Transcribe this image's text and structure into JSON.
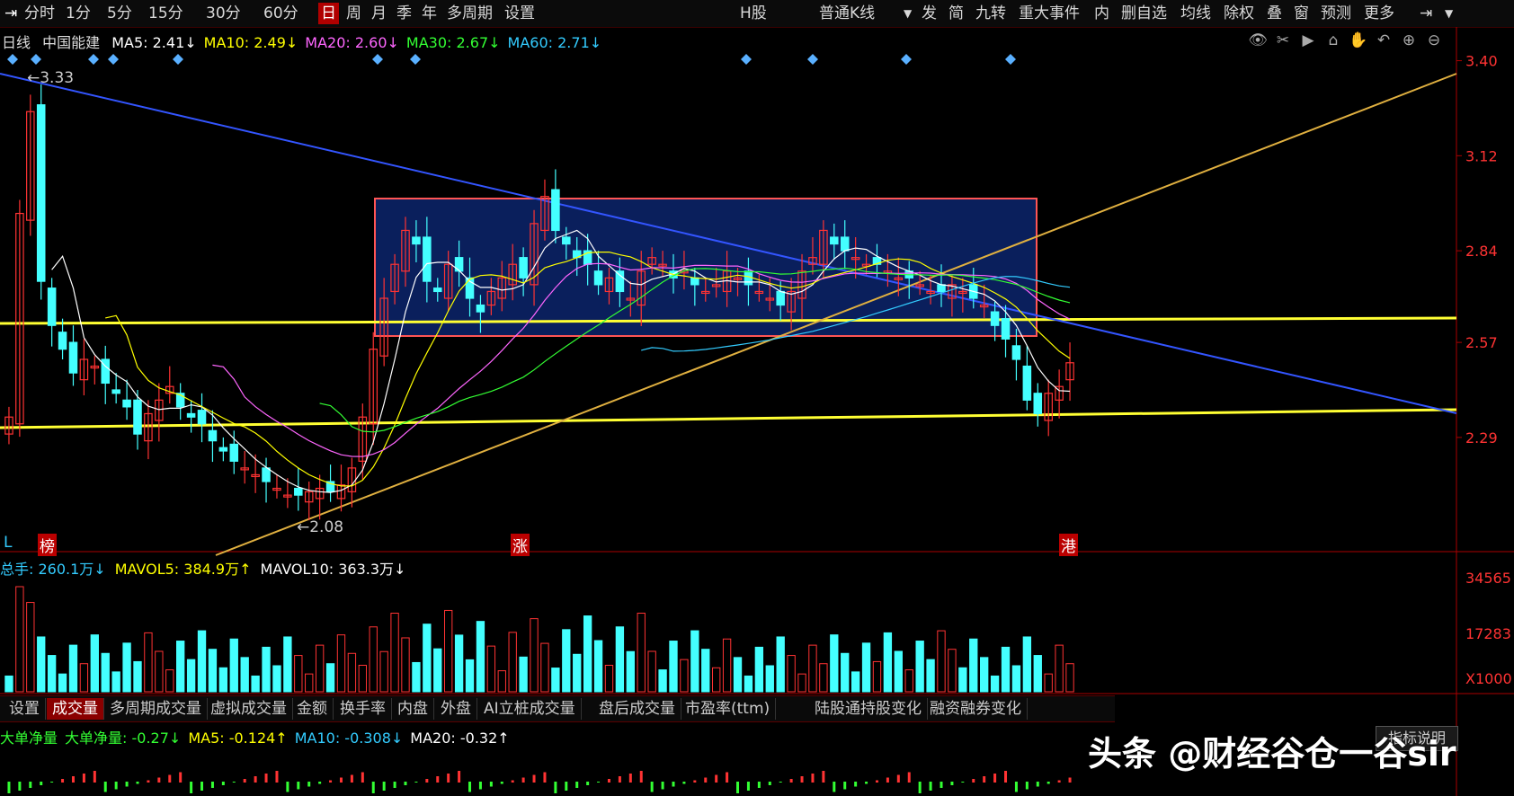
{
  "toolbar": {
    "left_items": [
      "分时",
      "1分",
      "5分",
      "15分",
      "30分",
      "60分",
      "日",
      "周",
      "月",
      "季",
      "年",
      "多周期",
      "设置"
    ],
    "active_index": 6,
    "hshare": "H股",
    "kline_type": "普通K线",
    "right_items": [
      "发",
      "简",
      "九转",
      "重大事件",
      "内",
      "删自选",
      "均线",
      "除权",
      "叠",
      "窗",
      "预测",
      "更多"
    ]
  },
  "info": {
    "period": "日线",
    "stock_name": "中国能建",
    "ma": [
      {
        "label": "MA5: 2.41↓",
        "color": "#ffffff"
      },
      {
        "label": "MA10: 2.49↓",
        "color": "#ffff00"
      },
      {
        "label": "MA20: 2.60↓",
        "color": "#ff66ff"
      },
      {
        "label": "MA30: 2.67↓",
        "color": "#33ff33"
      },
      {
        "label": "MA60: 2.71↓",
        "color": "#33ccff"
      }
    ]
  },
  "volume_info": [
    {
      "label": "总手: 260.1万↓",
      "color": "#33ccff"
    },
    {
      "label": "MAVOL5: 384.9万↑",
      "color": "#ffff00"
    },
    {
      "label": "MAVOL10: 363.3万↓",
      "color": "#ffffff"
    }
  ],
  "netflow_info": [
    {
      "label": "大单净量",
      "color": "#33ff33"
    },
    {
      "label": "大单净量: -0.27↓",
      "color": "#33ff33"
    },
    {
      "label": "MA5: -0.124↑",
      "color": "#ffff00"
    },
    {
      "label": "MA10: -0.308↓",
      "color": "#33ccff"
    },
    {
      "label": "MA20: -0.32↑",
      "color": "#ffffff"
    }
  ],
  "tabs": [
    "设置",
    "成交量",
    "多周期成交量",
    "虚拟成交量",
    "金额",
    "换手率",
    "内盘",
    "外盘",
    "AI立桩成交量",
    "盘后成交量",
    "市盈率(ttm)",
    "陆股通持股变化",
    "融资融券变化"
  ],
  "active_tab": 1,
  "help_label": "指标说明",
  "watermark": "头条 @财经谷仓一谷sir",
  "markers": {
    "left": "L",
    "bang": "榜",
    "zhang": "涨",
    "gang": "港"
  },
  "annotations": {
    "high": "3.33",
    "low": "2.08"
  },
  "colors": {
    "up": "#ff3333",
    "down": "#44ffff",
    "support": "#ffff33",
    "trend_down": "#3355ff",
    "trend_up": "#e0b040",
    "box_fill": "#0a1f5c",
    "box_border": "#ff5555"
  },
  "chart_data": {
    "type": "candlestick",
    "price_axis": {
      "ticks": [
        3.4,
        3.12,
        2.84,
        2.57,
        2.29
      ],
      "ylim": [
        1.98,
        3.42
      ]
    },
    "volume_axis": {
      "ticks": [
        "34565",
        "17283",
        "X1000"
      ]
    },
    "high": 3.33,
    "low": 2.08,
    "close_last": 2.51,
    "ma_last": {
      "MA5": 2.41,
      "MA10": 2.49,
      "MA20": 2.6,
      "MA30": 2.67,
      "MA60": 2.71
    },
    "closes": [
      2.35,
      2.95,
      3.25,
      2.75,
      2.62,
      2.55,
      2.48,
      2.52,
      2.5,
      2.45,
      2.42,
      2.38,
      2.3,
      2.36,
      2.4,
      2.44,
      2.38,
      2.35,
      2.33,
      2.28,
      2.25,
      2.22,
      2.2,
      2.18,
      2.16,
      2.14,
      2.12,
      2.12,
      2.13,
      2.14,
      2.13,
      2.15,
      2.2,
      2.35,
      2.55,
      2.7,
      2.8,
      2.9,
      2.86,
      2.75,
      2.72,
      2.8,
      2.78,
      2.7,
      2.66,
      2.72,
      2.76,
      2.8,
      2.76,
      2.92,
      3.0,
      2.9,
      2.86,
      2.82,
      2.8,
      2.74,
      2.76,
      2.72,
      2.7,
      2.78,
      2.82,
      2.8,
      2.76,
      2.78,
      2.74,
      2.72,
      2.74,
      2.78,
      2.76,
      2.74,
      2.72,
      2.7,
      2.68,
      2.72,
      2.78,
      2.82,
      2.9,
      2.86,
      2.84,
      2.82,
      2.8,
      2.8,
      2.78,
      2.76,
      2.76,
      2.74,
      2.72,
      2.72,
      2.74,
      2.72,
      2.7,
      2.68,
      2.62,
      2.58,
      2.52,
      2.4,
      2.36,
      2.42,
      2.44,
      2.51
    ],
    "annotations": [
      {
        "text": "3.33",
        "type": "high"
      },
      {
        "text": "2.08",
        "type": "low"
      }
    ]
  }
}
